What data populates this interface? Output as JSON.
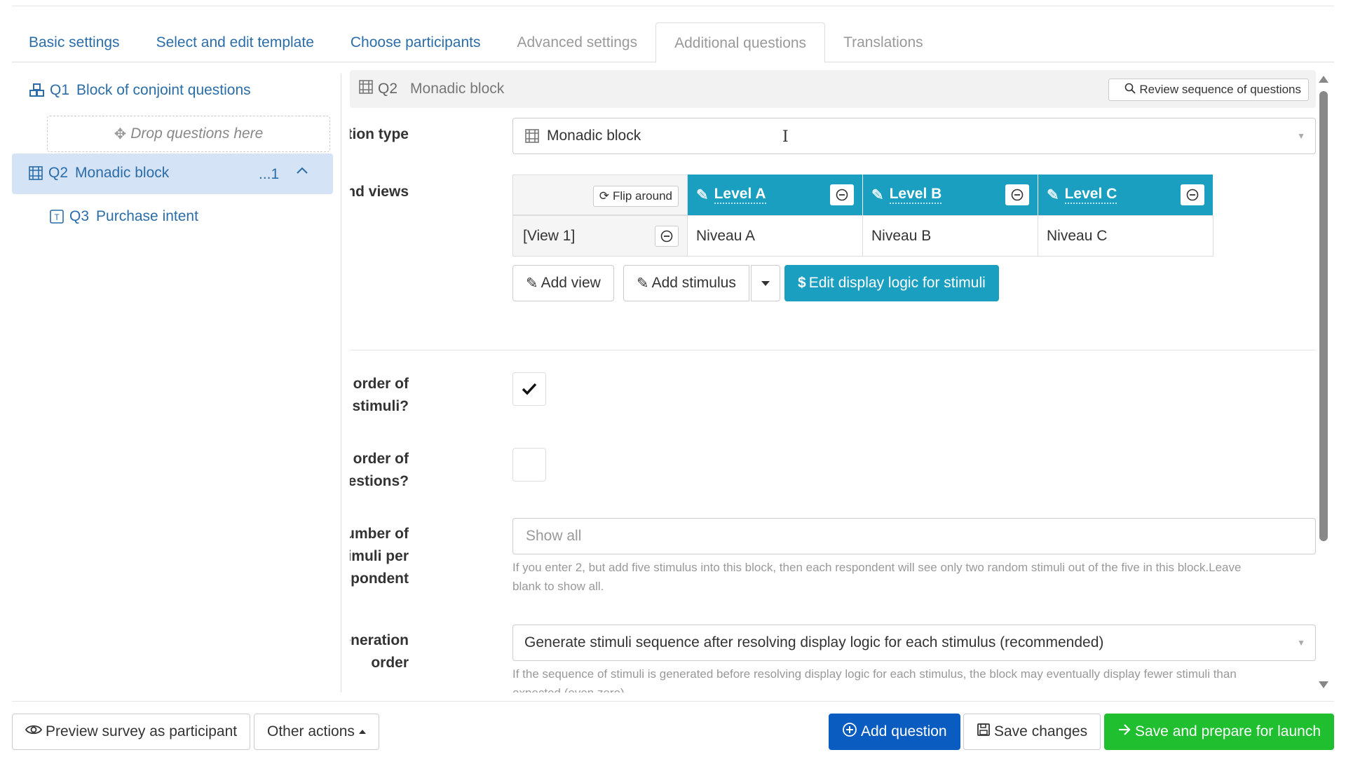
{
  "tabs": [
    {
      "label": "Basic settings"
    },
    {
      "label": "Select and edit template"
    },
    {
      "label": "Choose participants"
    },
    {
      "label": "Advanced settings"
    },
    {
      "label": "Additional questions"
    },
    {
      "label": "Translations"
    }
  ],
  "sidebar": {
    "q1": {
      "num": "Q1",
      "label": "Block of conjoint questions",
      "icon": "cubes-icon"
    },
    "drop_zone": "Drop questions here",
    "q2": {
      "num": "Q2",
      "label": "Monadic block",
      "count": "...1",
      "icon": "grid-icon"
    },
    "q3": {
      "num": "Q3",
      "label": "Purchase intent",
      "icon": "text-icon"
    }
  },
  "header": {
    "num": "Q2",
    "title": "Monadic block",
    "review_button": "Review sequence of questions"
  },
  "form": {
    "question_type_label": "Question type",
    "question_type_value": "Monadic block",
    "stimuli_label": "Stimuli and views",
    "flip_button": "Flip around",
    "levels": [
      {
        "head": "Level A",
        "value": "Niveau A"
      },
      {
        "head": "Level B",
        "value": "Niveau B"
      },
      {
        "head": "Level C",
        "value": "Niveau C"
      }
    ],
    "view_label": "[View 1]",
    "add_view": "Add view",
    "add_stimulus": "Add stimulus",
    "edit_logic": "Edit display logic for stimuli",
    "randomise_stimuli_label_1": "Randomise order of",
    "randomise_stimuli_label_2": "stimuli?",
    "randomise_stimuli_checked": true,
    "randomise_questions_label_1": "Randomise order of",
    "randomise_questions_label_2": "questions?",
    "randomise_questions_checked": false,
    "max_stimuli_label_1": "Maximum number of",
    "max_stimuli_label_2": "stimuli per",
    "max_stimuli_label_3": "respondent",
    "max_stimuli_placeholder": "Show all",
    "max_stimuli_help_1": "If you enter 2, but add five stimulus into this block, then each respondent will see only two random stimuli out of the five in this block.Leave",
    "max_stimuli_help_2": "blank to show all.",
    "sequence_label_1": "Sequence generation",
    "sequence_label_2": "order",
    "sequence_value": "Generate stimuli sequence after resolving display logic for each stimulus (recommended)",
    "sequence_help_1": "If the sequence of stimuli is generated before resolving display logic for each stimulus, the block may eventually display fewer stimuli than",
    "sequence_help_2": "expected (even zero)."
  },
  "footer": {
    "preview": "Preview survey as participant",
    "other_actions": "Other actions",
    "add_question": "Add question",
    "save_changes": "Save changes",
    "save_launch": "Save and prepare for launch"
  },
  "colors": {
    "link": "#2b6da8",
    "teal": "#1a9fc0",
    "primary": "#0a5cc0",
    "success": "#1fbf2f",
    "selected": "#d4e3f6"
  }
}
